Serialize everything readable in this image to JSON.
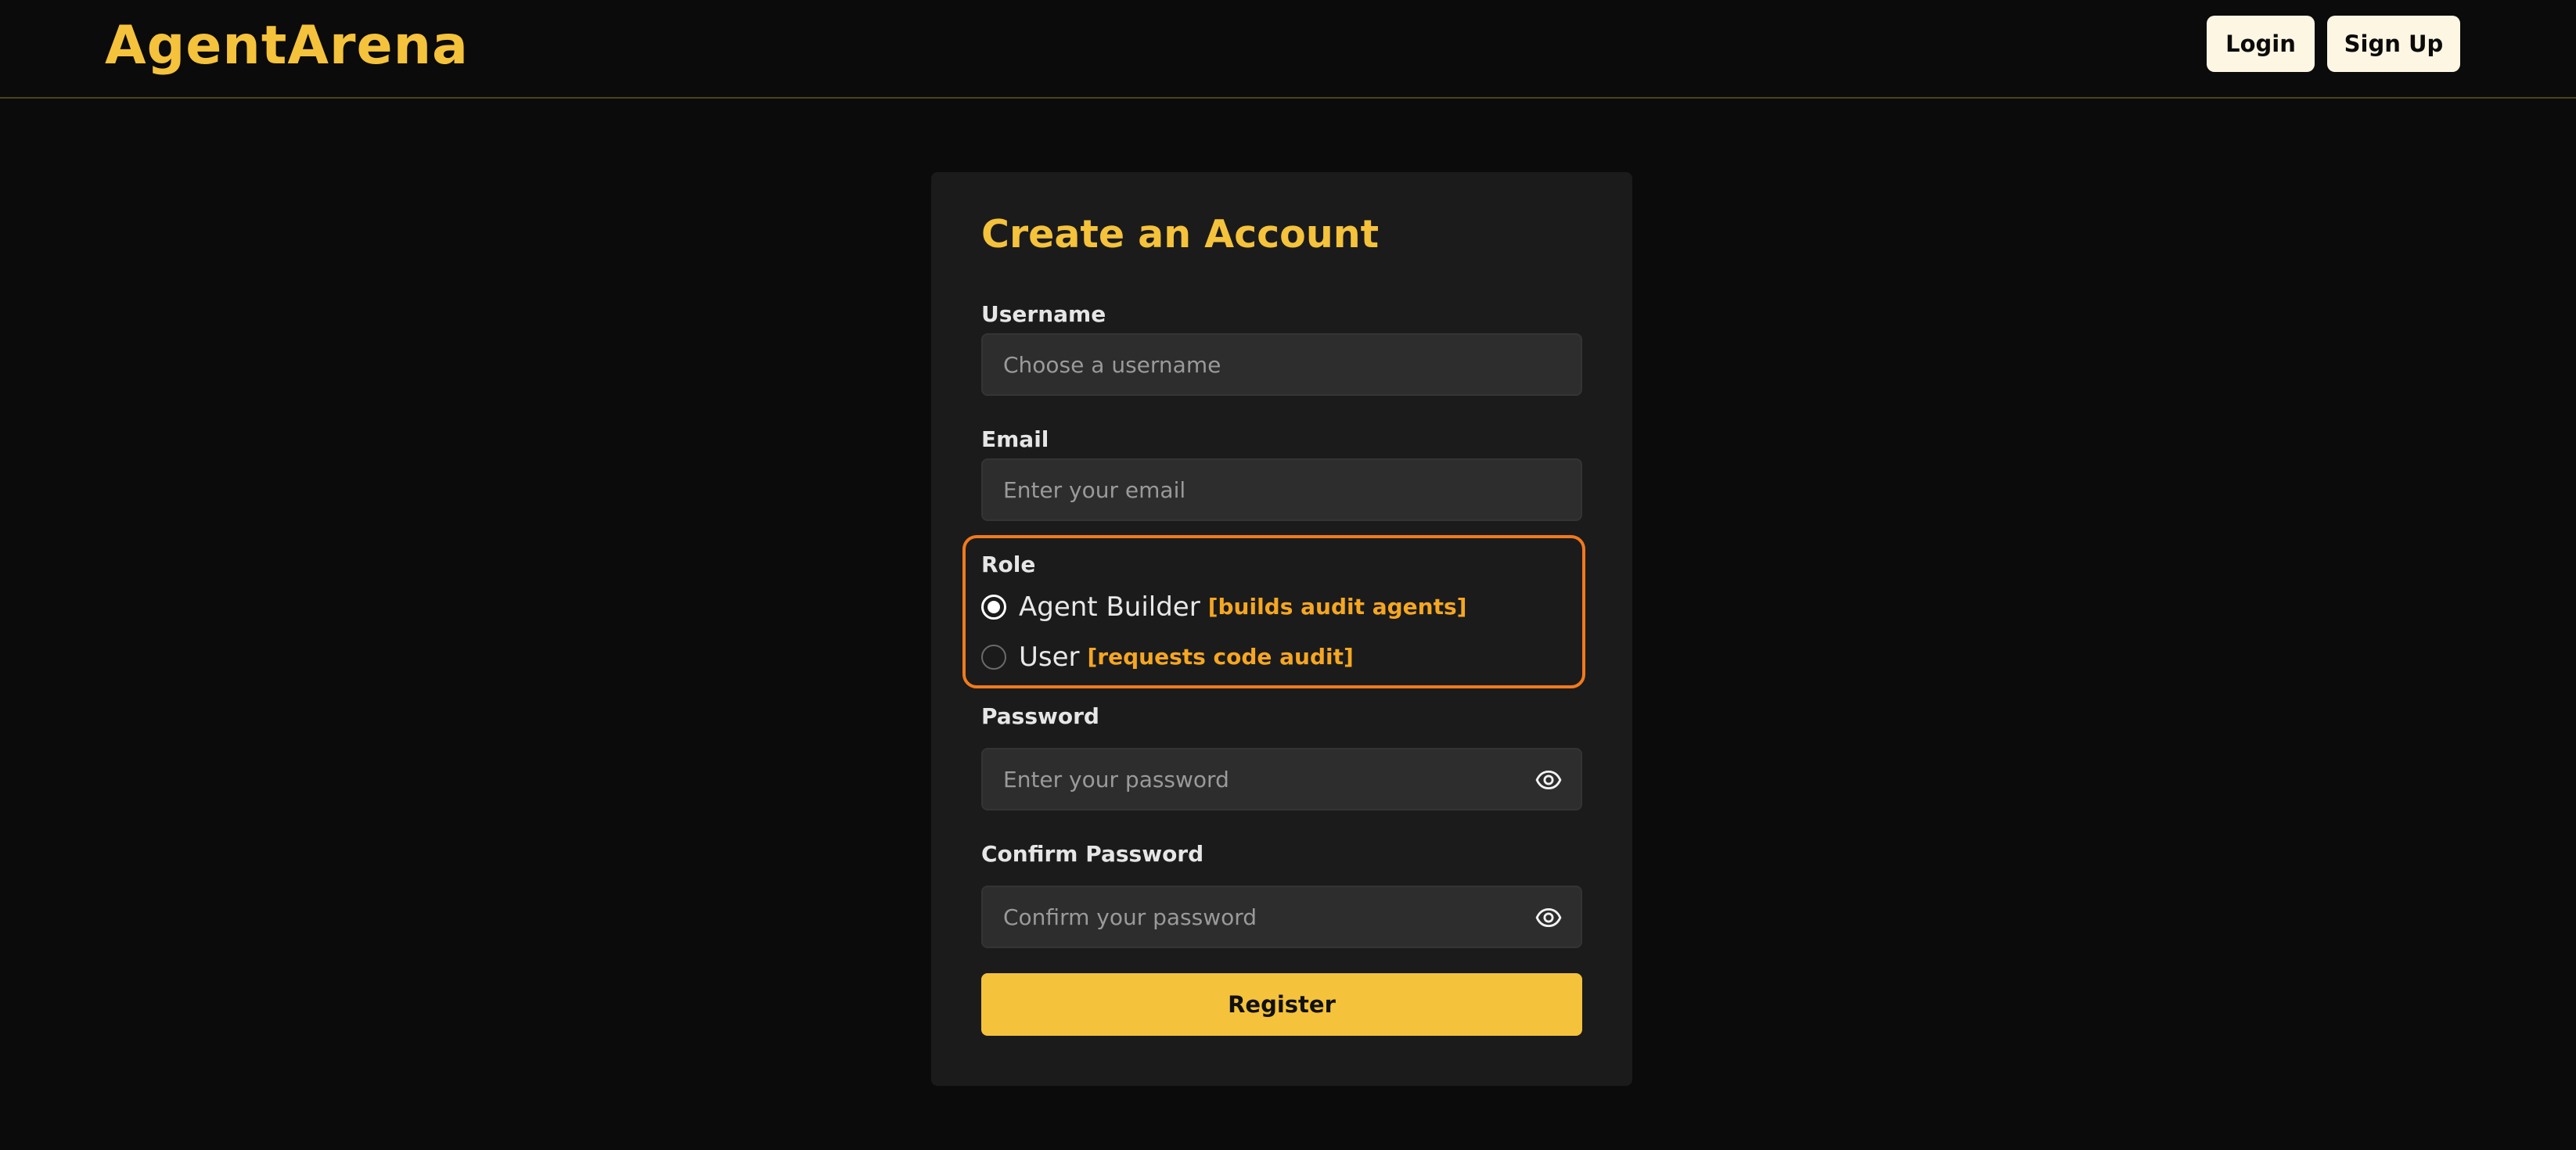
{
  "brand": {
    "name": "AgentArena",
    "accent_color": "#f5c23c"
  },
  "nav": {
    "login_label": "Login",
    "signup_label": "Sign Up"
  },
  "form": {
    "title": "Create an Account",
    "username": {
      "label": "Username",
      "placeholder": "Choose a username",
      "value": ""
    },
    "email": {
      "label": "Email",
      "placeholder": "Enter your email",
      "value": ""
    },
    "role": {
      "label": "Role",
      "highlight_color": "#f07a1e",
      "options": [
        {
          "label": "Agent Builder",
          "hint": "[builds audit agents]",
          "selected": true
        },
        {
          "label": "User",
          "hint": "[requests code audit]",
          "selected": false
        }
      ]
    },
    "password": {
      "label": "Password",
      "placeholder": "Enter your password",
      "value": "",
      "icon": "eye-icon"
    },
    "confirm_password": {
      "label": "Confirm Password",
      "placeholder": "Confirm your password",
      "value": "",
      "icon": "eye-icon"
    },
    "submit_label": "Register"
  }
}
